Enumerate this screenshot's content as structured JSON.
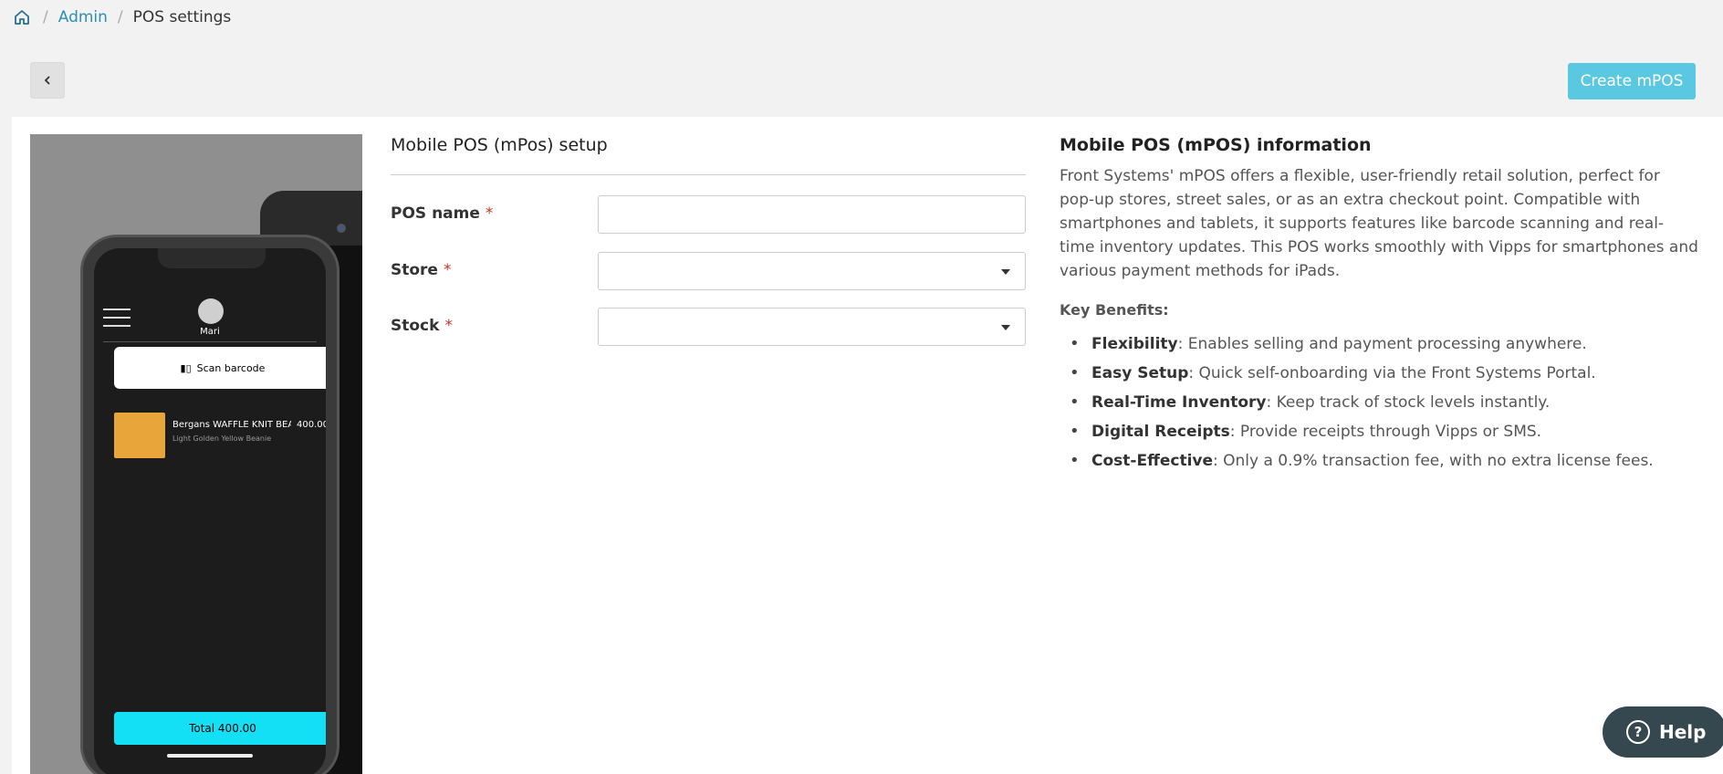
{
  "breadcrumb": {
    "home_icon": "home-icon",
    "items": [
      "Admin",
      "POS settings"
    ],
    "separator": "/"
  },
  "toolbar": {
    "back_icon": "chevron-left-icon",
    "create_label": "Create mPOS"
  },
  "promo": {
    "user_name": "Mari",
    "scan_label": "Scan barcode",
    "item_name": "Bergans WAFFLE KNIT BEANIE",
    "item_price": "400.00",
    "item_desc": "Light Golden Yellow Beanie",
    "total_label": "Total 400.00"
  },
  "form": {
    "title": "Mobile POS (mPos) setup",
    "required_mark": "*",
    "fields": {
      "pos_name": {
        "label": "POS name",
        "value": ""
      },
      "store": {
        "label": "Store",
        "value": ""
      },
      "stock": {
        "label": "Stock",
        "value": ""
      }
    }
  },
  "info": {
    "title": "Mobile POS (mPOS) information",
    "description": "Front Systems' mPOS offers a flexible, user-friendly retail solution, perfect for pop-up stores, street sales, or as an extra checkout point. Compatible with smartphones and tablets, it supports features like barcode scanning and real-time inventory updates. This POS works smoothly with Vipps for smartphones and various payment methods for iPads.",
    "benefits_title": "Key Benefits:",
    "benefits": [
      {
        "term": "Flexibility",
        "text": ": Enables selling and payment processing anywhere."
      },
      {
        "term": "Easy Setup",
        "text": ": Quick self-onboarding via the Front Systems Portal."
      },
      {
        "term": "Real-Time Inventory",
        "text": ": Keep track of stock levels instantly."
      },
      {
        "term": "Digital Receipts",
        "text": ": Provide receipts through Vipps or SMS."
      },
      {
        "term": "Cost-Effective",
        "text": ": Only a 0.9% transaction fee, with no extra license fees."
      }
    ]
  },
  "help": {
    "label": "Help",
    "icon": "question-circle-icon"
  },
  "colors": {
    "accent": "#5bc8e2",
    "link": "#2a8fb0",
    "help_bg": "#35474f",
    "required": "#c0392b"
  }
}
